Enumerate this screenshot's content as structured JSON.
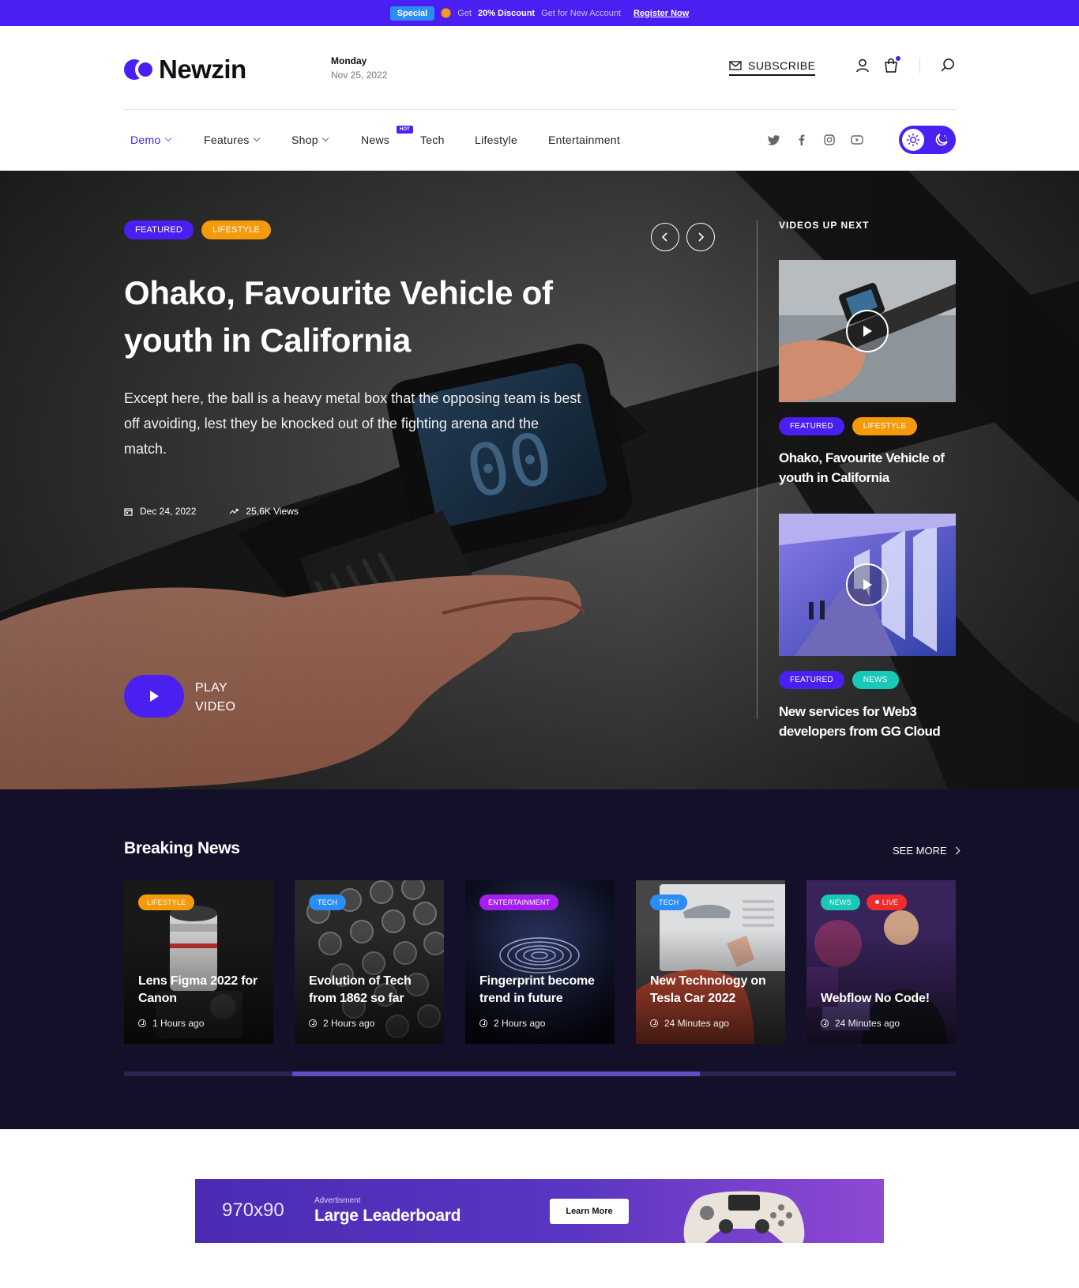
{
  "promo": {
    "badge": "Special",
    "text_pre": "Get",
    "text_bold": "20% Discount",
    "text_post": "Get for New Account",
    "link": "Register Now"
  },
  "header": {
    "logo_text": "Newzin",
    "day": "Monday",
    "date": "Nov 25, 2022",
    "subscribe_label": "SUBSCRIBE"
  },
  "nav": {
    "items": [
      {
        "label": "Demo",
        "has_dropdown": true,
        "active": true
      },
      {
        "label": "Features",
        "has_dropdown": true
      },
      {
        "label": "Shop",
        "has_dropdown": true
      },
      {
        "label": "News",
        "badge": "HOT"
      },
      {
        "label": "Tech"
      },
      {
        "label": "Lifestyle"
      },
      {
        "label": "Entertainment"
      }
    ],
    "social_icons": [
      "twitter-icon",
      "facebook-icon",
      "instagram-icon",
      "youtube-icon"
    ]
  },
  "hero": {
    "tags": [
      "FEATURED",
      "LIFESTYLE"
    ],
    "title": "Ohako, Favourite Vehicle of youth in California",
    "description": "Except here, the ball is a heavy metal box that the opposing team is best off avoiding, lest they be knocked out of the fighting arena and the match.",
    "date": "Dec 24, 2022",
    "views": "25,6K Views",
    "play_label_1": "PLAY",
    "play_label_2": "VIDEO"
  },
  "videos_up_next": {
    "heading": "VIDEOS UP NEXT",
    "items": [
      {
        "tags": [
          "FEATURED",
          "LIFESTYLE"
        ],
        "title": "Ohako, Favourite Vehicle of youth in California"
      },
      {
        "tags": [
          "FEATURED",
          "NEWS"
        ],
        "title": "New services for Web3 developers from GG Cloud"
      }
    ]
  },
  "breaking_news": {
    "title": "Breaking News",
    "see_more": "SEE MORE",
    "progress": 0.49,
    "items": [
      {
        "tags": [
          "LIFESTYLE"
        ],
        "title": "Lens Figma 2022 for Canon",
        "time": "1 Hours ago"
      },
      {
        "tags": [
          "TECH"
        ],
        "title": "Evolution of Tech from 1862 so far",
        "time": "2 Hours ago"
      },
      {
        "tags": [
          "ENTERTAINMENT"
        ],
        "title": "Fingerprint become trend in future",
        "time": "2 Hours ago"
      },
      {
        "tags": [
          "TECH"
        ],
        "title": "New Technology on Tesla Car 2022",
        "time": "24 Minutes ago"
      },
      {
        "tags": [
          "NEWS",
          "LIVE"
        ],
        "title": "Webflow No Code!",
        "time": "24 Minutes ago"
      }
    ]
  },
  "advert": {
    "size": "970x90",
    "small": "Advertisment",
    "big": "Large Leaderboard",
    "button": "Learn More"
  },
  "colors": {
    "primary": "#4a1ff2",
    "lifestyle": "#f59a0b",
    "news": "#17c9b6",
    "tech": "#2a8cf5",
    "entertainment": "#a51ef0",
    "live": "#ef2b2b",
    "dark_section": "#151029"
  }
}
